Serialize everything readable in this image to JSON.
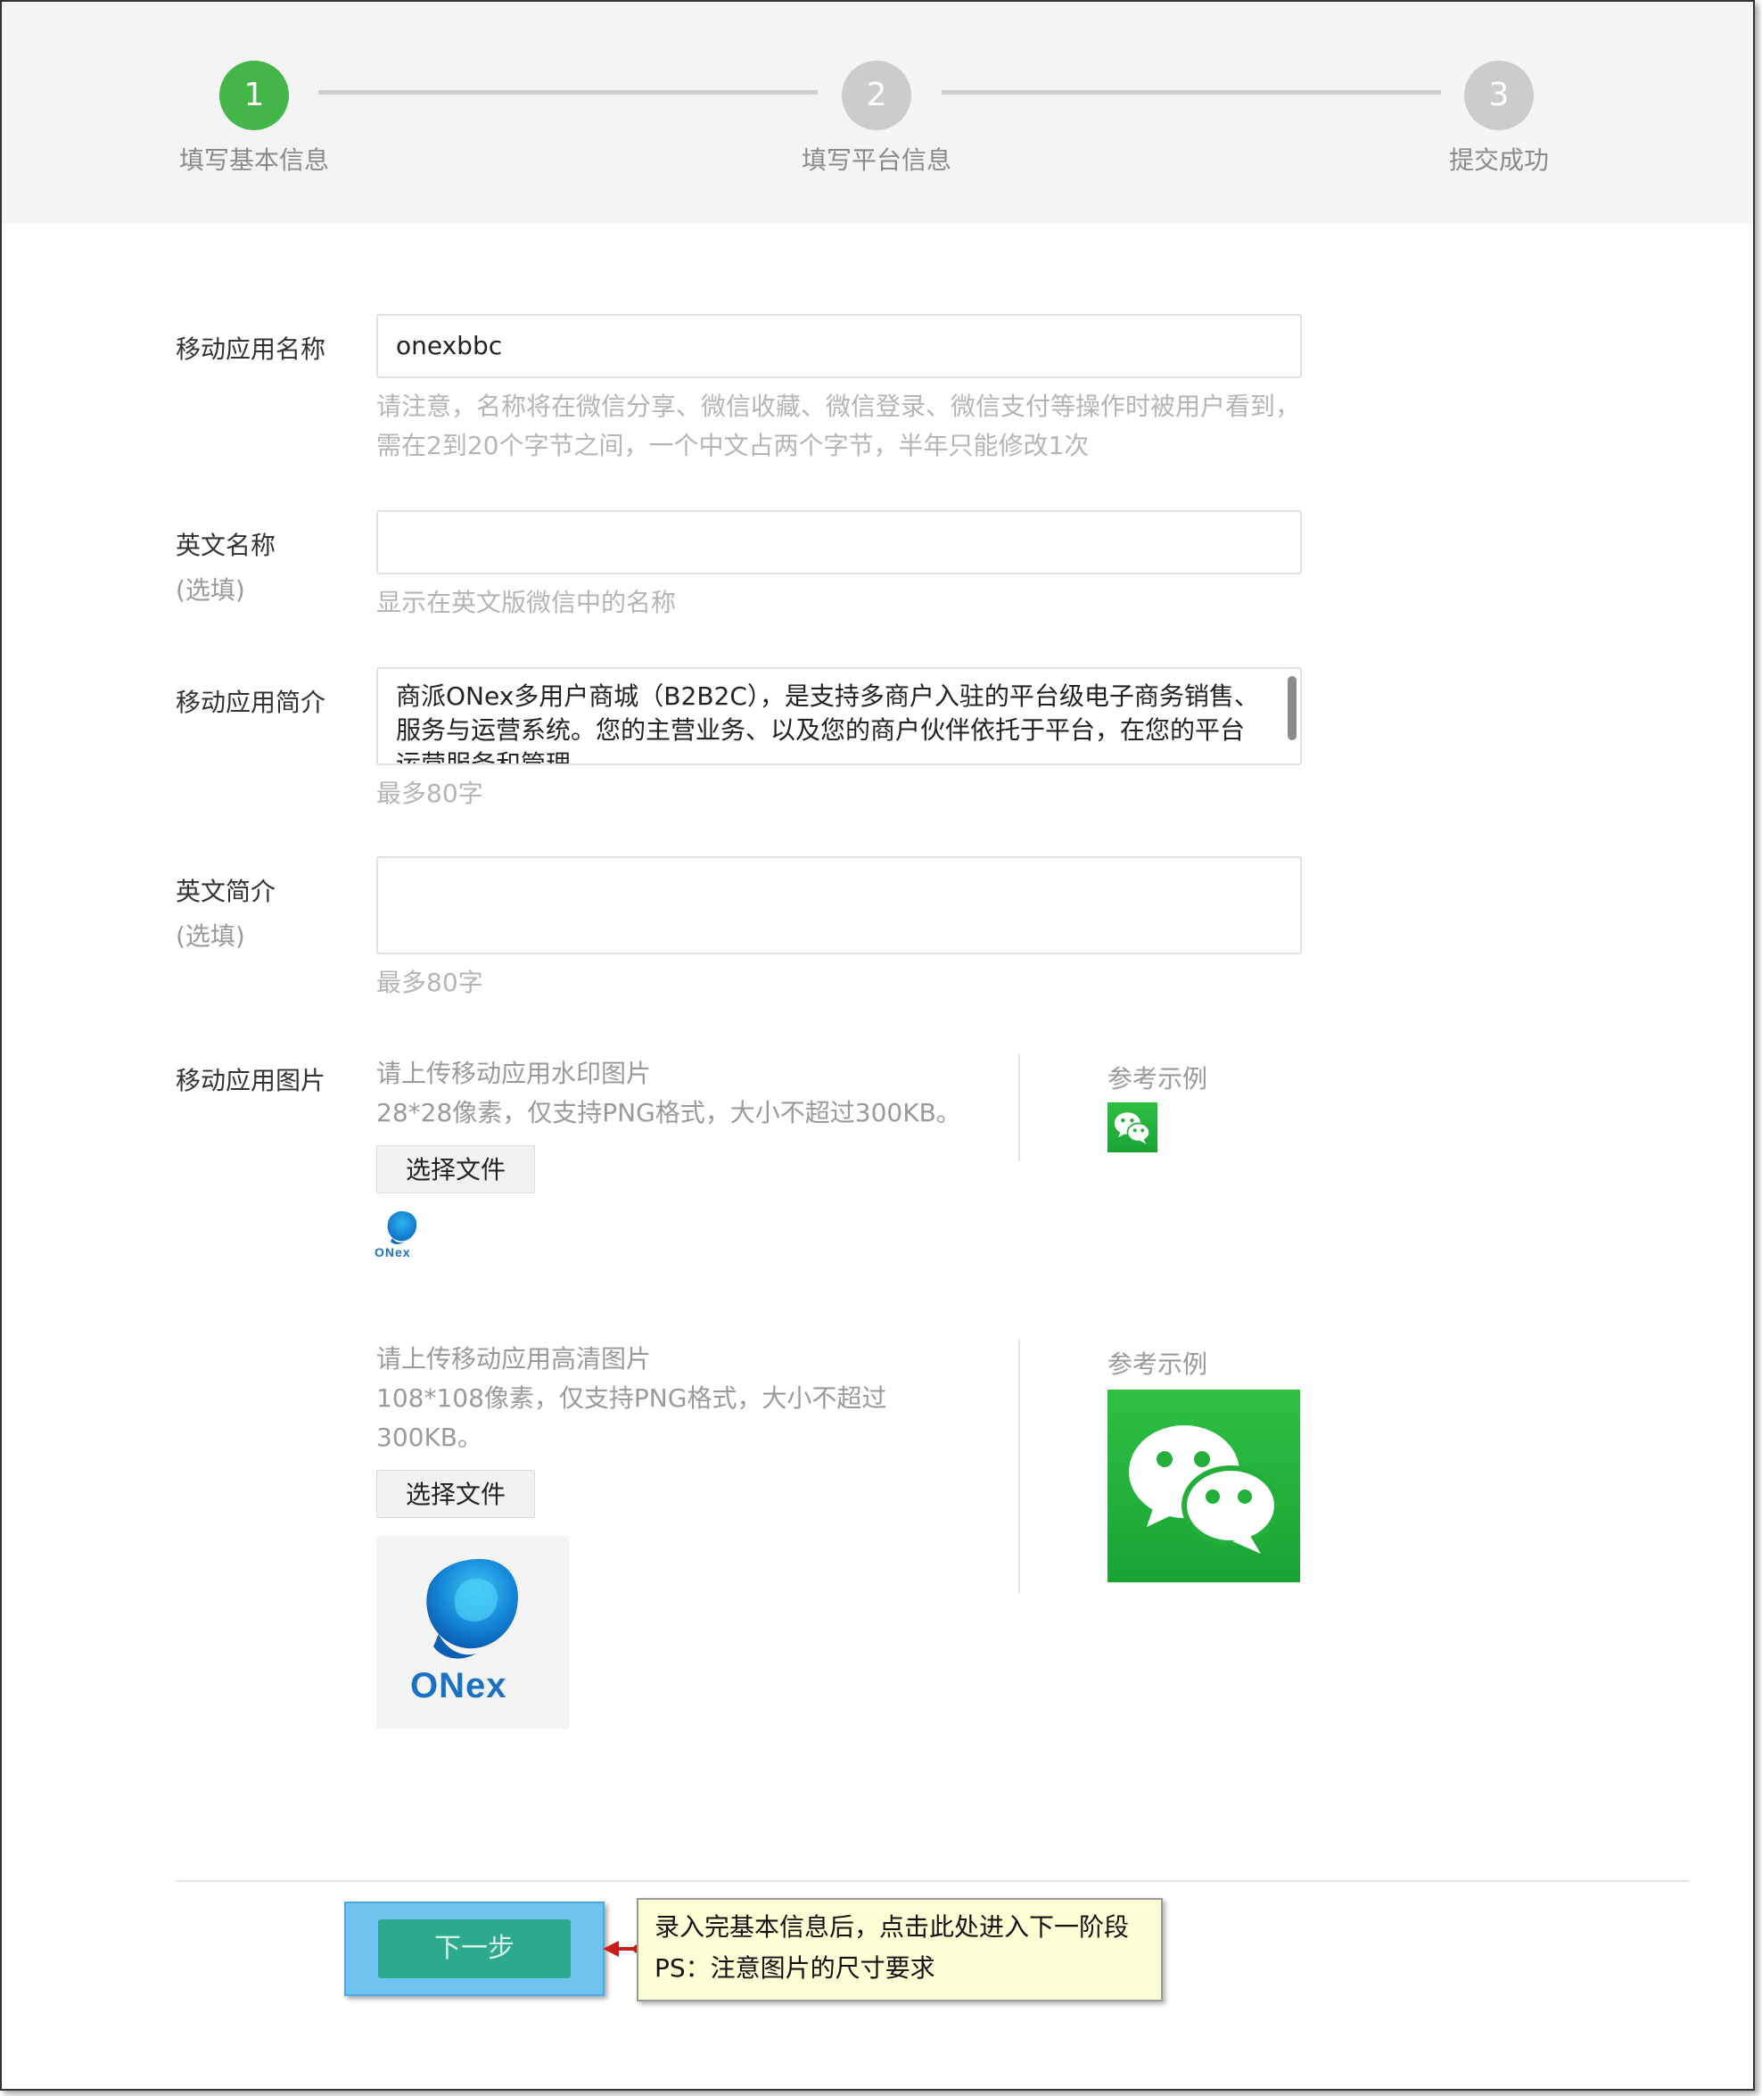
{
  "stepper": {
    "steps": [
      {
        "number": "1",
        "label": "填写基本信息"
      },
      {
        "number": "2",
        "label": "填写平台信息"
      },
      {
        "number": "3",
        "label": "提交成功"
      }
    ],
    "active_color": "#44b549",
    "inactive_color": "#cccccc"
  },
  "form": {
    "app_name": {
      "label": "移动应用名称",
      "value": "onexbbc",
      "hint_line1": "请注意，名称将在微信分享、微信收藏、微信登录、微信支付等操作时被用户看到，",
      "hint_line2": "需在2到20个字节之间，一个中文占两个字节，半年只能修改1次"
    },
    "english_name": {
      "label": "英文名称",
      "optional": "(选填)",
      "value": "",
      "hint": "显示在英文版微信中的名称"
    },
    "app_intro": {
      "label": "移动应用简介",
      "value": "商派ONex多用户商城（B2B2C），是支持多商户入驻的平台级电子商务销售、服务与运营系统。您的主营业务、以及您的商户伙伴依托于平台，在您的平台运营服务和管理",
      "hint": "最多80字"
    },
    "english_intro": {
      "label": "英文简介",
      "optional": "(选填)",
      "value": "",
      "hint": "最多80字"
    },
    "app_images": {
      "label": "移动应用图片",
      "watermark": {
        "title": "请上传移动应用水印图片",
        "desc": "28*28像素，仅支持PNG格式，大小不超过300KB。",
        "button": "选择文件",
        "ref_label": "参考示例",
        "preview_logo_text": "ONex"
      },
      "hd": {
        "title": "请上传移动应用高清图片",
        "desc_line1": "108*108像素，仅支持PNG格式，大小不超过",
        "desc_line2": "300KB。",
        "button": "选择文件",
        "ref_label": "参考示例",
        "preview_logo_text": "ONex"
      }
    }
  },
  "footer": {
    "next_button": "下一步",
    "note_line1": "录入完基本信息后，点击此处进入下一阶段",
    "note_line2": "PS：注意图片的尺寸要求"
  },
  "colors": {
    "wechat_green": "#1aad19",
    "next_button": "#2da98d",
    "highlight_box": "#6fc3ef",
    "arrow": "#cc1b1b",
    "note_bg": "#ffffd6"
  }
}
